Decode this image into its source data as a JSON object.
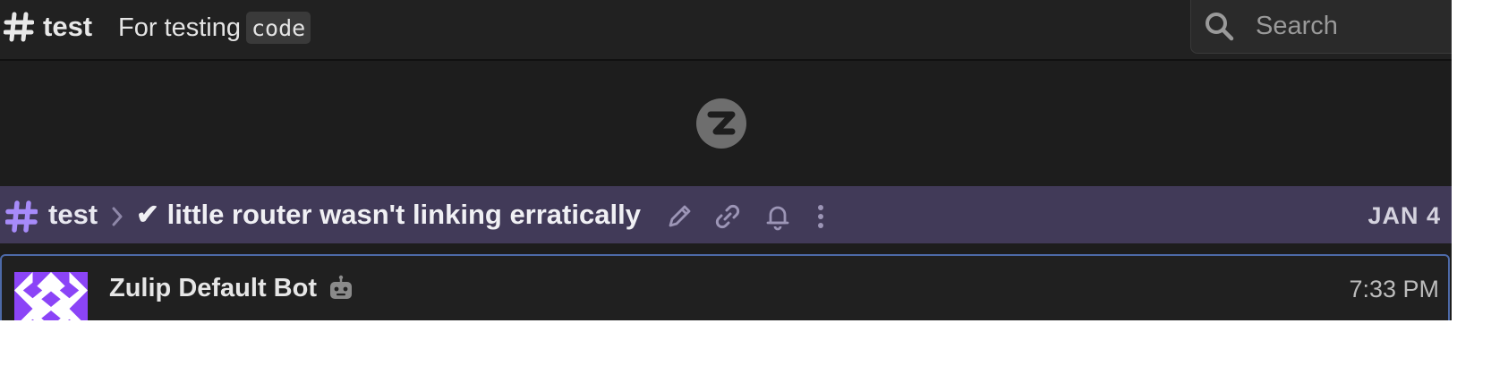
{
  "header": {
    "stream_name": "test",
    "description_text": "For testing",
    "description_code": "code",
    "search": {
      "placeholder": "Search",
      "icon": "search-icon"
    }
  },
  "recipient_bar": {
    "stream_name": "test",
    "topic": "✔ little router wasn't linking erratically",
    "date": "JAN 4",
    "actions": [
      "edit-topic-icon",
      "copy-link-icon",
      "notification-bell-icon",
      "more-options-icon"
    ],
    "accent_color": "#a78bfa"
  },
  "message": {
    "sender": "Zulip Default Bot",
    "time": "7:33 PM",
    "avatar_color": "#7c3aed"
  }
}
